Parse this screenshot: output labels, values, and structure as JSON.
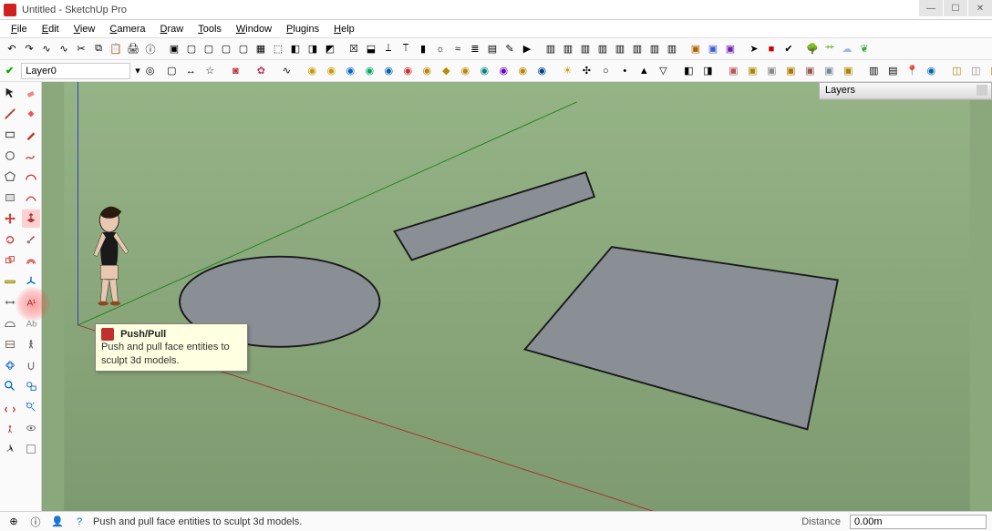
{
  "window": {
    "title": "Untitled - SketchUp Pro"
  },
  "menus": [
    "File",
    "Edit",
    "View",
    "Camera",
    "Draw",
    "Tools",
    "Window",
    "Plugins",
    "Help"
  ],
  "layer": {
    "current": "Layer0"
  },
  "tooltip": {
    "title": "Push/Pull",
    "body": "Push and pull face entities to sculpt 3d models."
  },
  "status": {
    "hint": "Push and pull face entities to sculpt 3d models.",
    "distance_label": "Distance",
    "distance_value": "0.00m"
  },
  "layers_panel": {
    "title": "Layers"
  },
  "colors": {
    "ground": "#8aa87b",
    "ground_dark": "#789868",
    "face": "#8a8f96",
    "edge": "#1a1a1a",
    "axis_red": "#b02020",
    "axis_green": "#208020",
    "axis_blue": "#2030c0"
  },
  "left_tools": [
    [
      "select-tool",
      "eraser-tool"
    ],
    [
      "line-tool",
      "paint-bucket-tool"
    ],
    [
      "rectangle-tool",
      "pencil-tool"
    ],
    [
      "circle-tool",
      "freehand-tool"
    ],
    [
      "polygon-tool",
      "arc-tool"
    ],
    [
      "shape-tool",
      "two-pt-arc-tool"
    ],
    [
      "move-tool",
      "push-pull-tool"
    ],
    [
      "rotate-tool",
      "follow-me-tool"
    ],
    [
      "scale-tool",
      "offset-tool"
    ],
    [
      "tape-tool",
      "axes-tool"
    ],
    [
      "dimension-tool",
      "text-tool"
    ],
    [
      "protractor-tool",
      "3d-text-tool"
    ],
    [
      "section-tool",
      "walk-tool"
    ],
    [
      "orbit-tool",
      "pan-tool"
    ],
    [
      "zoom-tool",
      "zoom-window-tool"
    ],
    [
      "look-tool",
      "zoom-extents-tool"
    ],
    [
      "previous-tool",
      "position-camera-tool"
    ],
    [
      "photo-match-tool",
      "outliner-tool"
    ]
  ]
}
